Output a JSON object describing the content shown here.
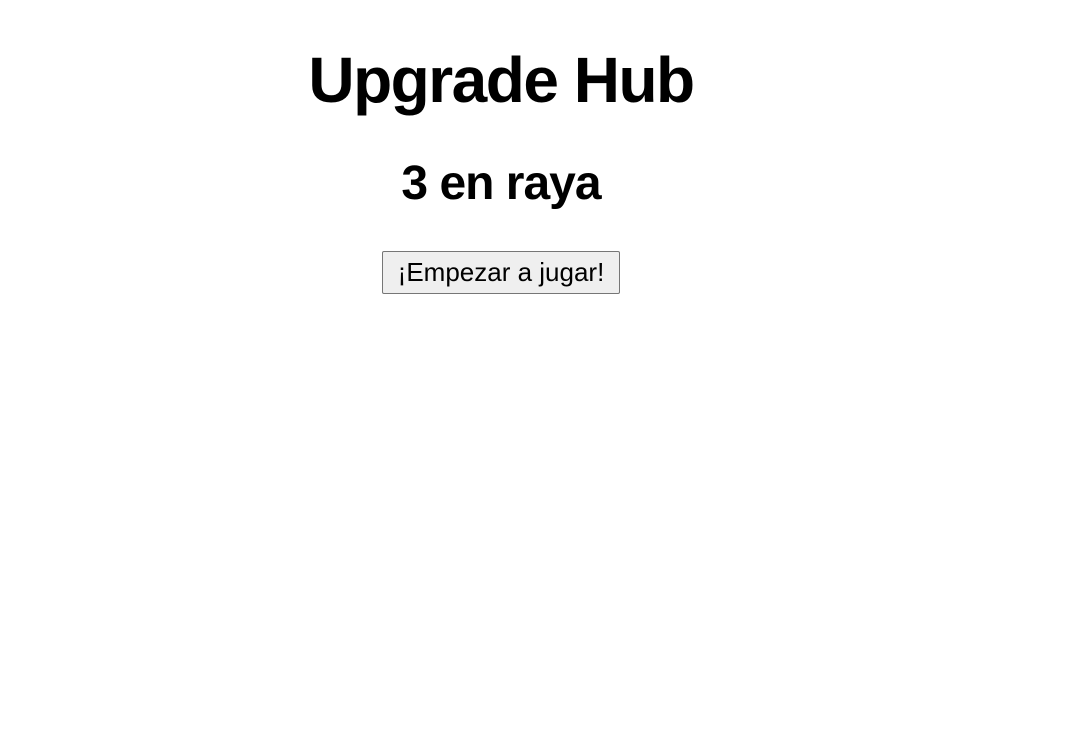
{
  "header": {
    "site_title": "Upgrade Hub"
  },
  "game": {
    "title": "3 en raya",
    "start_label": "¡Empezar a jugar!"
  }
}
